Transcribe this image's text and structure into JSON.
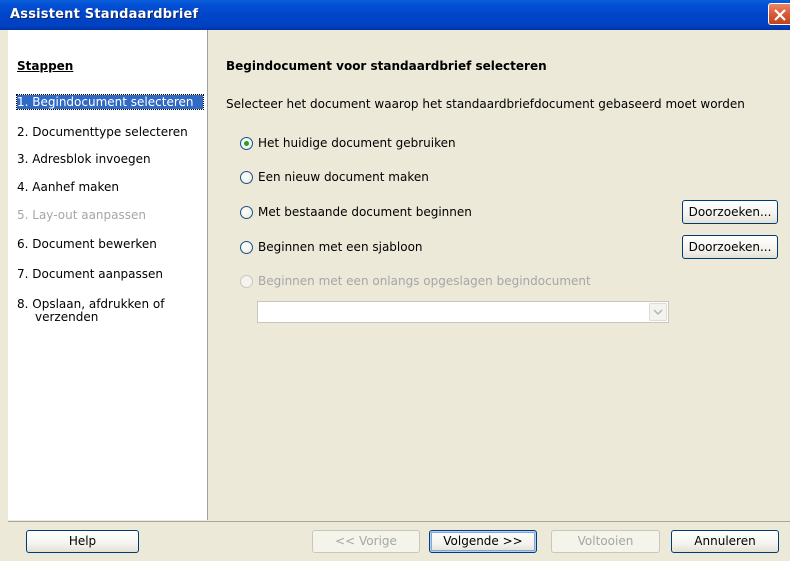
{
  "window": {
    "title": "Assistent Standaardbrief"
  },
  "steps": {
    "title": "Stappen",
    "items": [
      {
        "label": "1.  Begindocument selecteren",
        "state": "selected"
      },
      {
        "label": "2.  Documenttype selecteren",
        "state": "normal"
      },
      {
        "label": "3.  Adresblok invoegen",
        "state": "normal"
      },
      {
        "label": "4.  Aanhef maken",
        "state": "normal"
      },
      {
        "label": "5.  Lay-out aanpassen",
        "state": "disabled"
      },
      {
        "label": "6.  Document bewerken",
        "state": "normal"
      },
      {
        "label": "7.  Document aanpassen",
        "state": "normal"
      },
      {
        "label": "8.  Opslaan, afdrukken of",
        "state": "normal"
      },
      {
        "label": "verzenden",
        "state": "normal"
      }
    ]
  },
  "main": {
    "heading": "Begindocument voor standaardbrief selecteren",
    "description": "Selecteer het document waarop het standaardbriefdocument gebaseerd moet worden",
    "options": [
      {
        "label": "Het huidige document gebruiken",
        "checked": true,
        "disabled": false
      },
      {
        "label": "Een nieuw document maken",
        "checked": false,
        "disabled": false
      },
      {
        "label": "Met bestaande document beginnen",
        "checked": false,
        "disabled": false
      },
      {
        "label": "Beginnen met een sjabloon",
        "checked": false,
        "disabled": false
      },
      {
        "label": "Beginnen met een onlangs opgeslagen begindocument",
        "checked": false,
        "disabled": true
      }
    ],
    "browse_label": "Doorzoeken...",
    "recent_value": ""
  },
  "buttons": {
    "help": "Help",
    "previous": "<< Vorige",
    "next": "Volgende >>",
    "finish": "Voltooien",
    "cancel": "Annuleren"
  },
  "colors": {
    "selection": "#316ac5",
    "titlebar": "#0045c8",
    "close": "#d95a37"
  }
}
